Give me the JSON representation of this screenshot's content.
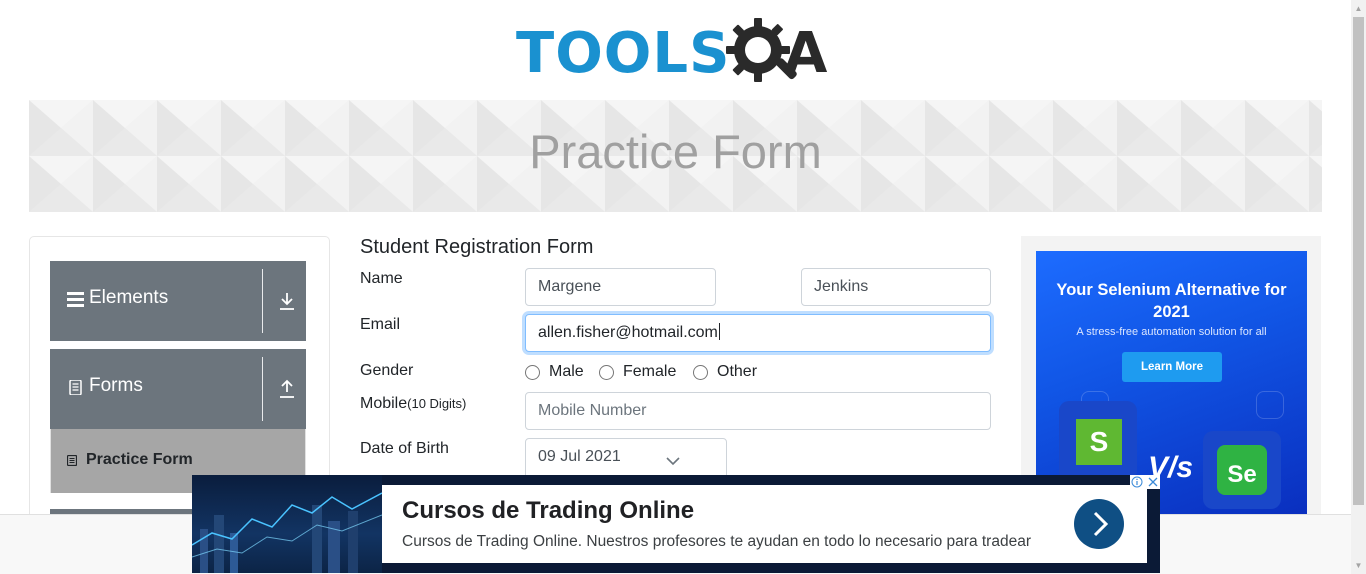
{
  "logo": {
    "text": "TOOLS",
    "suffix": "A",
    "colors": {
      "blue": "#1a91d0",
      "dark": "#2a2a2a"
    }
  },
  "banner": {
    "title": "Practice Form"
  },
  "sidebar": {
    "groups": [
      {
        "label": "Elements",
        "icon": "hamburger-icon",
        "action_icon": "download-arrow-icon"
      },
      {
        "label": "Forms",
        "icon": "document-icon",
        "action_icon": "upload-arrow-icon"
      }
    ],
    "active_item": {
      "label": "Practice Form",
      "icon": "form-icon"
    }
  },
  "form": {
    "title": "Student Registration Form",
    "name_label": "Name",
    "first_name": "Margene",
    "last_name": "Jenkins",
    "email_label": "Email",
    "email_value": "allen.fisher@hotmail.com",
    "gender_label": "Gender",
    "gender_options": [
      "Male",
      "Female",
      "Other"
    ],
    "mobile_label": "Mobile",
    "mobile_hint": "(10 Digits)",
    "mobile_placeholder": "Mobile Number",
    "dob_label": "Date of Birth",
    "dob_value": "09 Jul 2021"
  },
  "right_ad": {
    "title": "Your Selenium Alternative for 2021",
    "subtitle": "A stress-free automation solution for all",
    "button": "Learn More",
    "vs": "V/s",
    "s_letter": "S",
    "se_letters": "Se",
    "colors": {
      "bg": "#1156e6",
      "button": "#1e9bf0"
    }
  },
  "bottom_ad": {
    "title": "Cursos de Trading Online",
    "description": "Cursos de Trading Online. Nuestros profesores te ayudan en todo lo necesario para tradear"
  },
  "colors": {
    "sidebar_group": "#6c757d",
    "active_item": "#a6a6a6",
    "focus": "#80bdff"
  }
}
